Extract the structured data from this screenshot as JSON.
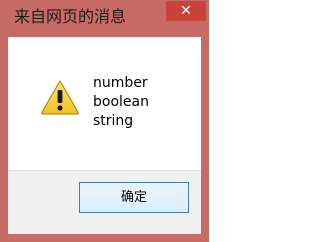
{
  "window": {
    "title": "来自网页的消息",
    "close_glyph": "✕"
  },
  "dialog": {
    "icon": "warning-icon",
    "message_lines": [
      "number",
      "boolean",
      "string"
    ],
    "ok_label": "确定"
  },
  "colors": {
    "frame": "#c76b66",
    "close_button": "#c7433b",
    "footer": "#f0f0f0",
    "button_border": "#3c7fb1",
    "warning_fill": "#f2c31d"
  }
}
